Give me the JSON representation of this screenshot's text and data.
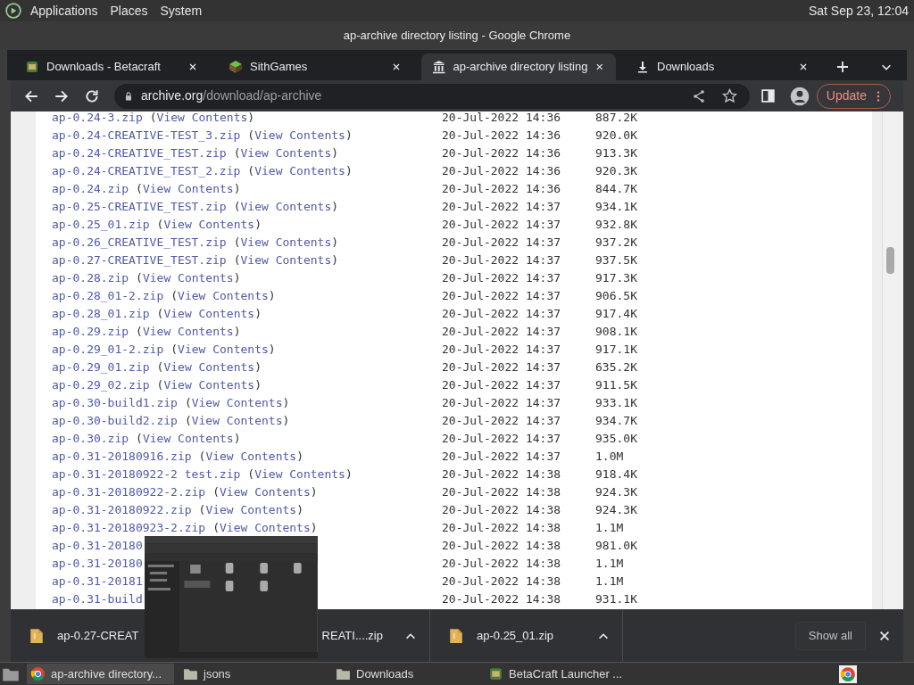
{
  "top_panel": {
    "menus": [
      "Applications",
      "Places",
      "System"
    ],
    "clock": "Sat Sep 23, 12:04"
  },
  "window": {
    "title": "ap-archive directory listing - Google Chrome"
  },
  "tabs": [
    {
      "label": "Downloads - Betacraft",
      "selected": false
    },
    {
      "label": "SithGames",
      "selected": false
    },
    {
      "label": "ap-archive directory listing",
      "selected": true
    },
    {
      "label": "Downloads",
      "selected": false
    }
  ],
  "address": {
    "host": "archive.org",
    "path": "/download/ap-archive"
  },
  "update_button": "Update",
  "listing": [
    {
      "name": "ap-0.24-3.zip",
      "view": "(View Contents)",
      "date": "20-Jul-2022 14:36",
      "size": "887.2K"
    },
    {
      "name": "ap-0.24-CREATIVE-TEST_3.zip",
      "view": "(View Contents)",
      "date": "20-Jul-2022 14:36",
      "size": "920.0K"
    },
    {
      "name": "ap-0.24-CREATIVE_TEST.zip",
      "view": "(View Contents)",
      "date": "20-Jul-2022 14:36",
      "size": "913.3K"
    },
    {
      "name": "ap-0.24-CREATIVE_TEST_2.zip",
      "view": "(View Contents)",
      "date": "20-Jul-2022 14:36",
      "size": "920.3K"
    },
    {
      "name": "ap-0.24.zip",
      "view": "(View Contents)",
      "date": "20-Jul-2022 14:36",
      "size": "844.7K"
    },
    {
      "name": "ap-0.25-CREATIVE_TEST.zip",
      "view": "(View Contents)",
      "date": "20-Jul-2022 14:37",
      "size": "934.1K"
    },
    {
      "name": "ap-0.25_01.zip",
      "view": "(View Contents)",
      "date": "20-Jul-2022 14:37",
      "size": "932.8K"
    },
    {
      "name": "ap-0.26_CREATIVE_TEST.zip",
      "view": "(View Contents)",
      "date": "20-Jul-2022 14:37",
      "size": "937.2K"
    },
    {
      "name": "ap-0.27-CREATIVE_TEST.zip",
      "view": "(View Contents)",
      "date": "20-Jul-2022 14:37",
      "size": "937.5K"
    },
    {
      "name": "ap-0.28.zip",
      "view": "(View Contents)",
      "date": "20-Jul-2022 14:37",
      "size": "917.3K"
    },
    {
      "name": "ap-0.28_01-2.zip",
      "view": "(View Contents)",
      "date": "20-Jul-2022 14:37",
      "size": "906.5K"
    },
    {
      "name": "ap-0.28_01.zip",
      "view": "(View Contents)",
      "date": "20-Jul-2022 14:37",
      "size": "917.4K"
    },
    {
      "name": "ap-0.29.zip",
      "view": "(View Contents)",
      "date": "20-Jul-2022 14:37",
      "size": "908.1K"
    },
    {
      "name": "ap-0.29_01-2.zip",
      "view": "(View Contents)",
      "date": "20-Jul-2022 14:37",
      "size": "917.1K"
    },
    {
      "name": "ap-0.29_01.zip",
      "view": "(View Contents)",
      "date": "20-Jul-2022 14:37",
      "size": "635.2K"
    },
    {
      "name": "ap-0.29_02.zip",
      "view": "(View Contents)",
      "date": "20-Jul-2022 14:37",
      "size": "911.5K"
    },
    {
      "name": "ap-0.30-build1.zip",
      "view": "(View Contents)",
      "date": "20-Jul-2022 14:37",
      "size": "933.1K"
    },
    {
      "name": "ap-0.30-build2.zip",
      "view": "(View Contents)",
      "date": "20-Jul-2022 14:37",
      "size": "934.7K"
    },
    {
      "name": "ap-0.30.zip",
      "view": "(View Contents)",
      "date": "20-Jul-2022 14:37",
      "size": "935.0K"
    },
    {
      "name": "ap-0.31-20180916.zip",
      "view": "(View Contents)",
      "date": "20-Jul-2022 14:37",
      "size": "1.0M"
    },
    {
      "name": "ap-0.31-20180922-2 test.zip",
      "view": "(View Contents)",
      "date": "20-Jul-2022 14:38",
      "size": "918.4K"
    },
    {
      "name": "ap-0.31-20180922-2.zip",
      "view": "(View Contents)",
      "date": "20-Jul-2022 14:38",
      "size": "924.3K"
    },
    {
      "name": "ap-0.31-20180922.zip",
      "view": "(View Contents)",
      "date": "20-Jul-2022 14:38",
      "size": "924.3K"
    },
    {
      "name": "ap-0.31-20180923-2.zip",
      "view": "(View Contents)",
      "date": "20-Jul-2022 14:38",
      "size": "1.1M"
    },
    {
      "name": "ap-0.31-20180",
      "date": "20-Jul-2022 14:38",
      "size": "981.0K"
    },
    {
      "name": "ap-0.31-20180",
      "date": "20-Jul-2022 14:38",
      "size": "1.1M"
    },
    {
      "name": "ap-0.31-20181",
      "date": "20-Jul-2022 14:38",
      "size": "1.1M"
    },
    {
      "name": "ap-0.31-build",
      "date": "20-Jul-2022 14:38",
      "size": "931.1K"
    }
  ],
  "downloads": [
    {
      "parts": [
        "ap-0.27-CREAT",
        "REATI....zip"
      ]
    },
    {
      "parts": [
        "ap-0.25_01.zip"
      ]
    }
  ],
  "show_all": "Show all",
  "taskbar": [
    {
      "label": "ap-archive directory...",
      "selected": true
    },
    {
      "label": "jsons",
      "selected": false
    },
    {
      "label": "Downloads",
      "selected": false
    },
    {
      "label": "BetaCraft Launcher ...",
      "selected": false
    }
  ]
}
